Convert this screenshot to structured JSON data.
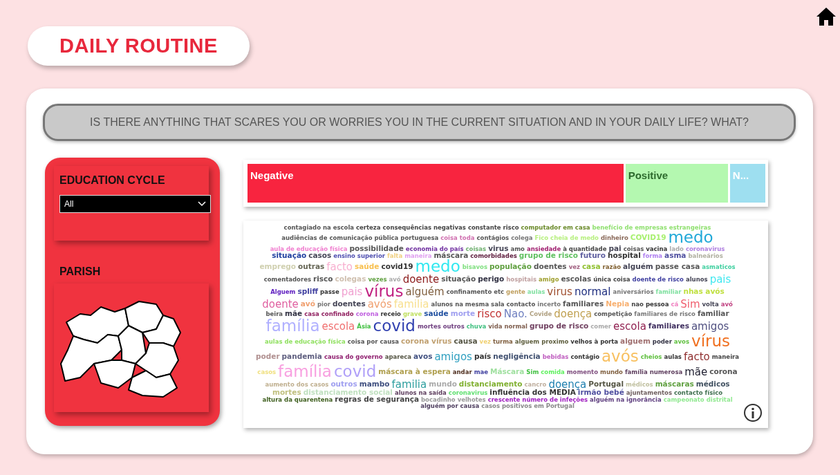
{
  "title": "DAILY ROUTINE",
  "question": "IS THERE ANYTHING THAT SCARES YOU OR WORRIES YOU IN THE CURRENT SITUATION AND IN YOUR DAILY LIFE? WHAT?",
  "filters": {
    "education_cycle": {
      "label": "EDUCATION CYCLE",
      "value": "All"
    },
    "parish": {
      "label": "PARISH"
    }
  },
  "segments": [
    {
      "label": "Negative",
      "color": "#f8243f"
    },
    {
      "label": "Positive",
      "color": "#b4f8b0"
    },
    {
      "label": "N...",
      "color": "#9edff0"
    }
  ],
  "words": [
    {
      "text": "contagiado na escola",
      "color": "#555555",
      "kind": "s"
    },
    {
      "text": "certeza consequências negativas",
      "color": "#444444",
      "kind": "s"
    },
    {
      "text": "constante risco",
      "color": "#444444",
      "kind": "s"
    },
    {
      "text": "computador em casa",
      "color": "#6a8a2a",
      "kind": "s"
    },
    {
      "text": "benefício de empresas estrangeiras",
      "color": "#90e070",
      "kind": "s"
    },
    {
      "text": "audiências de comunicação pública portuguesa",
      "color": "#555555",
      "kind": "s"
    },
    {
      "text": "coisa toda",
      "color": "#d070b0",
      "kind": "s"
    },
    {
      "text": "contágios",
      "color": "#555555",
      "kind": "s"
    },
    {
      "text": "colega",
      "color": "#777777",
      "kind": "s"
    },
    {
      "text": "Fico cheia de medo",
      "color": "#b8f080",
      "kind": "s"
    },
    {
      "text": "dinheiro",
      "color": "#8a6a5a",
      "kind": "s"
    },
    {
      "text": "COVID19",
      "color": "#a8f070",
      "kind": "m"
    },
    {
      "text": "medo",
      "color": "#20a8d8",
      "kind": "xl"
    },
    {
      "text": "aula de educação física",
      "color": "#f080d0",
      "kind": "s"
    },
    {
      "text": "possibilidade",
      "color": "#555555",
      "kind": "m"
    },
    {
      "text": "economia do país",
      "color": "#7030a0",
      "kind": "s"
    },
    {
      "text": "coisas",
      "color": "#70b070",
      "kind": "s"
    },
    {
      "text": "virus",
      "color": "#444455",
      "kind": "m"
    },
    {
      "text": "amo",
      "color": "#555555",
      "kind": "s"
    },
    {
      "text": "ansiedade",
      "color": "#a02070",
      "kind": "s"
    },
    {
      "text": "à quantidade",
      "color": "#444444",
      "kind": "s"
    },
    {
      "text": "pai",
      "color": "#444455",
      "kind": "m"
    },
    {
      "text": "coisas",
      "color": "#555555",
      "kind": "s"
    },
    {
      "text": "vacina",
      "color": "#333333",
      "kind": "s"
    },
    {
      "text": "lado",
      "color": "#aaaaaa",
      "kind": "s"
    },
    {
      "text": "coronavirus",
      "color": "#b080e0",
      "kind": "s"
    },
    {
      "text": "situação",
      "color": "#2040a0",
      "kind": "m"
    },
    {
      "text": "casos",
      "color": "#444455",
      "kind": "m"
    },
    {
      "text": "ensino superior",
      "color": "#5050b0",
      "kind": "s"
    },
    {
      "text": "falta",
      "color": "#f0d080",
      "kind": "s"
    },
    {
      "text": "maneira",
      "color": "#e0a0f0",
      "kind": "s"
    },
    {
      "text": "máscara",
      "color": "#555555",
      "kind": "m"
    },
    {
      "text": "comorbidades",
      "color": "#602040",
      "kind": "s"
    },
    {
      "text": "grupo de risco",
      "color": "#60c060",
      "kind": "m"
    },
    {
      "text": "futuro",
      "color": "#6060a0",
      "kind": "m"
    },
    {
      "text": "hospital",
      "color": "#333333",
      "kind": "m"
    },
    {
      "text": "forma",
      "color": "#b080f0",
      "kind": "s"
    },
    {
      "text": "asma",
      "color": "#5050a0",
      "kind": "m"
    },
    {
      "text": "balneários",
      "color": "#b0b0a0",
      "kind": "s"
    },
    {
      "text": "emprego",
      "color": "#d0d0b0",
      "kind": "m"
    },
    {
      "text": "outras",
      "color": "#666655",
      "kind": "m"
    },
    {
      "text": "facto",
      "color": "#f8b0d0",
      "kind": "l"
    },
    {
      "text": "saúde",
      "color": "#f8c050",
      "kind": "m"
    },
    {
      "text": "covid19",
      "color": "#333333",
      "kind": "m"
    },
    {
      "text": "medo",
      "color": "#30e8f0",
      "kind": "xl"
    },
    {
      "text": "bisavos",
      "color": "#80e080",
      "kind": "s"
    },
    {
      "text": "população",
      "color": "#60a040",
      "kind": "m"
    },
    {
      "text": "doentes",
      "color": "#555555",
      "kind": "m"
    },
    {
      "text": "vez",
      "color": "#a06080",
      "kind": "s"
    },
    {
      "text": "casa",
      "color": "#90c030",
      "kind": "m"
    },
    {
      "text": "razão",
      "color": "#806030",
      "kind": "s"
    },
    {
      "text": "alguém",
      "color": "#444455",
      "kind": "m"
    },
    {
      "text": "passe casa",
      "color": "#555555",
      "kind": "m"
    },
    {
      "text": "asmaticos",
      "color": "#40d0a0",
      "kind": "s"
    },
    {
      "text": "comentadores",
      "color": "#555555",
      "kind": "s"
    },
    {
      "text": "risco",
      "color": "#555555",
      "kind": "m"
    },
    {
      "text": "colegas",
      "color": "#d0c0b0",
      "kind": "m"
    },
    {
      "text": "vezes",
      "color": "#60a040",
      "kind": "s"
    },
    {
      "text": "avó",
      "color": "#aaaaaa",
      "kind": "s"
    },
    {
      "text": "doente",
      "color": "#8b1a1a",
      "kind": "l"
    },
    {
      "text": "situação",
      "color": "#555555",
      "kind": "m"
    },
    {
      "text": "perigo",
      "color": "#333344",
      "kind": "m"
    },
    {
      "text": "hospitais",
      "color": "#c0a0a0",
      "kind": "s"
    },
    {
      "text": "amigo",
      "color": "#a0a030",
      "kind": "s"
    },
    {
      "text": "escolas",
      "color": "#555555",
      "kind": "m"
    },
    {
      "text": "única coisa",
      "color": "#444444",
      "kind": "s"
    },
    {
      "text": "doente de risco",
      "color": "#4040a0",
      "kind": "s"
    },
    {
      "text": "alunos",
      "color": "#444455",
      "kind": "s"
    },
    {
      "text": "pais",
      "color": "#40e8f0",
      "kind": "l"
    },
    {
      "text": "Alguem",
      "color": "#6020c0",
      "kind": "s"
    },
    {
      "text": "spliff",
      "color": "#4040a0",
      "kind": "m"
    },
    {
      "text": "passe",
      "color": "#333333",
      "kind": "s"
    },
    {
      "text": "pais",
      "color": "#f0a0d0",
      "kind": "l"
    },
    {
      "text": "vírus",
      "color": "#c02080",
      "kind": "xl"
    },
    {
      "text": "alguém",
      "color": "#806040",
      "kind": "l"
    },
    {
      "text": "confinamento",
      "color": "#555555",
      "kind": "s"
    },
    {
      "text": "etc",
      "color": "#555555",
      "kind": "s"
    },
    {
      "text": "gente",
      "color": "#c0a060",
      "kind": "s"
    },
    {
      "text": "aulas",
      "color": "#80e0a0",
      "kind": "s"
    },
    {
      "text": "virus",
      "color": "#a05030",
      "kind": "l"
    },
    {
      "text": "normal",
      "color": "#203080",
      "kind": "l"
    },
    {
      "text": "aniversários",
      "color": "#777777",
      "kind": "s"
    },
    {
      "text": "familiar",
      "color": "#80e0a0",
      "kind": "s"
    },
    {
      "text": "nhas avós",
      "color": "#c0e040",
      "kind": "m"
    },
    {
      "text": "doente",
      "color": "#e060a0",
      "kind": "l"
    },
    {
      "text": "avó",
      "color": "#f0a070",
      "kind": "m"
    },
    {
      "text": "pior",
      "color": "#777777",
      "kind": "s"
    },
    {
      "text": "doentes",
      "color": "#444455",
      "kind": "m"
    },
    {
      "text": "avós",
      "color": "#f0a070",
      "kind": "l"
    },
    {
      "text": "familia",
      "color": "#f8e090",
      "kind": "l"
    },
    {
      "text": "alunos na mesma sala",
      "color": "#555555",
      "kind": "s"
    },
    {
      "text": "contacto",
      "color": "#555555",
      "kind": "s"
    },
    {
      "text": "incerto",
      "color": "#777777",
      "kind": "s"
    },
    {
      "text": "familiares",
      "color": "#555555",
      "kind": "m"
    },
    {
      "text": "Nepia",
      "color": "#f8b070",
      "kind": "m"
    },
    {
      "text": "nao",
      "color": "#444444",
      "kind": "s"
    },
    {
      "text": "pessoa",
      "color": "#333333",
      "kind": "s"
    },
    {
      "text": "cá",
      "color": "#f080c0",
      "kind": "s"
    },
    {
      "text": "Sim",
      "color": "#f06070",
      "kind": "l"
    },
    {
      "text": "volta",
      "color": "#444455",
      "kind": "s"
    },
    {
      "text": "avó",
      "color": "#c04080",
      "kind": "s"
    },
    {
      "text": "beira",
      "color": "#555555",
      "kind": "s"
    },
    {
      "text": "mãe",
      "color": "#333344",
      "kind": "m"
    },
    {
      "text": "casa confinado",
      "color": "#902060",
      "kind": "s"
    },
    {
      "text": "corona",
      "color": "#c060e0",
      "kind": "s"
    },
    {
      "text": "receio",
      "color": "#333333",
      "kind": "s"
    },
    {
      "text": "grave",
      "color": "#c0e060",
      "kind": "s"
    },
    {
      "text": "saúde",
      "color": "#2050a0",
      "kind": "m"
    },
    {
      "text": "morte",
      "color": "#a0a0f0",
      "kind": "m"
    },
    {
      "text": "risco",
      "color": "#c03030",
      "kind": "l"
    },
    {
      "text": "Nao.",
      "color": "#7080c0",
      "kind": "l"
    },
    {
      "text": "Covide",
      "color": "#b0a080",
      "kind": "s"
    },
    {
      "text": "doença",
      "color": "#c0a050",
      "kind": "l"
    },
    {
      "text": "competição",
      "color": "#555555",
      "kind": "s"
    },
    {
      "text": "familiares de risco",
      "color": "#777777",
      "kind": "s"
    },
    {
      "text": "familiar",
      "color": "#555555",
      "kind": "m"
    },
    {
      "text": "família",
      "color": "#b0b0ff",
      "kind": "xl"
    },
    {
      "text": "escola",
      "color": "#f07070",
      "kind": "l"
    },
    {
      "text": "Ásia",
      "color": "#40c040",
      "kind": "s"
    },
    {
      "text": "covid",
      "color": "#3040b0",
      "kind": "xl"
    },
    {
      "text": "mortes",
      "color": "#704080",
      "kind": "s"
    },
    {
      "text": "outros",
      "color": "#704080",
      "kind": "s"
    },
    {
      "text": "chuva",
      "color": "#40c080",
      "kind": "s"
    },
    {
      "text": "vida normal",
      "color": "#806050",
      "kind": "s"
    },
    {
      "text": "grupo de risco",
      "color": "#704060",
      "kind": "m"
    },
    {
      "text": "comer",
      "color": "#aaaaaa",
      "kind": "s"
    },
    {
      "text": "escola",
      "color": "#902050",
      "kind": "l"
    },
    {
      "text": "familiares",
      "color": "#403060",
      "kind": "m"
    },
    {
      "text": "amigos",
      "color": "#505080",
      "kind": "l"
    },
    {
      "text": "aulas de educação física",
      "color": "#90e060",
      "kind": "s"
    },
    {
      "text": "coisa por causa",
      "color": "#555555",
      "kind": "s"
    },
    {
      "text": "corona vírus",
      "color": "#c0a070",
      "kind": "m"
    },
    {
      "text": "causa",
      "color": "#555544",
      "kind": "m"
    },
    {
      "text": "vez",
      "color": "#f0d070",
      "kind": "s"
    },
    {
      "text": "turma",
      "color": "#806040",
      "kind": "s"
    },
    {
      "text": "alguem proximo",
      "color": "#606040",
      "kind": "s"
    },
    {
      "text": "velhos à porta",
      "color": "#333333",
      "kind": "s"
    },
    {
      "text": "alguem",
      "color": "#a07070",
      "kind": "m"
    },
    {
      "text": "poder",
      "color": "#333344",
      "kind": "s"
    },
    {
      "text": "avos",
      "color": "#60c040",
      "kind": "s"
    },
    {
      "text": "vírus",
      "color": "#f07020",
      "kind": "xl"
    },
    {
      "text": "poder",
      "color": "#b09090",
      "kind": "m"
    },
    {
      "text": "pandemia",
      "color": "#606080",
      "kind": "m"
    },
    {
      "text": "causa do governo",
      "color": "#902070",
      "kind": "s"
    },
    {
      "text": "apareca",
      "color": "#555544",
      "kind": "s"
    },
    {
      "text": "avos",
      "color": "#405080",
      "kind": "m"
    },
    {
      "text": "amigos",
      "color": "#30a0c0",
      "kind": "l"
    },
    {
      "text": "país",
      "color": "#333333",
      "kind": "m"
    },
    {
      "text": "negligência",
      "color": "#405070",
      "kind": "m"
    },
    {
      "text": "bebidas",
      "color": "#c060c0",
      "kind": "s"
    },
    {
      "text": "contágio",
      "color": "#333333",
      "kind": "s"
    },
    {
      "text": "avós",
      "color": "#f8c060",
      "kind": "xl"
    },
    {
      "text": "cheios",
      "color": "#60c040",
      "kind": "s"
    },
    {
      "text": "aulas",
      "color": "#333333",
      "kind": "s"
    },
    {
      "text": "facto",
      "color": "#903030",
      "kind": "l"
    },
    {
      "text": "maneira",
      "color": "#444444",
      "kind": "s"
    },
    {
      "text": "casos",
      "color": "#f0e080",
      "kind": "s"
    },
    {
      "text": "família",
      "color": "#f8a0e0",
      "kind": "xl"
    },
    {
      "text": "covid",
      "color": "#b0a0f8",
      "kind": "xl"
    },
    {
      "text": "máscara à espera",
      "color": "#b0a050",
      "kind": "m"
    },
    {
      "text": "andar",
      "color": "#503020",
      "kind": "s"
    },
    {
      "text": "mae",
      "color": "#4040a0",
      "kind": "s"
    },
    {
      "text": "Máscara",
      "color": "#a0e0a0",
      "kind": "m"
    },
    {
      "text": "Sim",
      "color": "#40c040",
      "kind": "s"
    },
    {
      "text": "comida",
      "color": "#60f060",
      "kind": "s"
    },
    {
      "text": "momento",
      "color": "#805080",
      "kind": "s"
    },
    {
      "text": "mundo",
      "color": "#806040",
      "kind": "s"
    },
    {
      "text": "família numerosa",
      "color": "#604060",
      "kind": "s"
    },
    {
      "text": "mãe",
      "color": "#222233",
      "kind": "l"
    },
    {
      "text": "corona",
      "color": "#555555",
      "kind": "m"
    },
    {
      "text": "aumento dos casos",
      "color": "#c0b090",
      "kind": "s"
    },
    {
      "text": "outros",
      "color": "#a0a0f0",
      "kind": "m"
    },
    {
      "text": "mambo",
      "color": "#405080",
      "kind": "m"
    },
    {
      "text": "familia",
      "color": "#30a0a0",
      "kind": "l"
    },
    {
      "text": "mundo",
      "color": "#aaaaaa",
      "kind": "m"
    },
    {
      "text": "distanciamento",
      "color": "#80b030",
      "kind": "m"
    },
    {
      "text": "cancro",
      "color": "#c0b0a0",
      "kind": "s"
    },
    {
      "text": "doença",
      "color": "#2080b0",
      "kind": "l"
    },
    {
      "text": "Portugal",
      "color": "#555544",
      "kind": "m"
    },
    {
      "text": "médicos",
      "color": "#c0c0a0",
      "kind": "s"
    },
    {
      "text": "máscaras",
      "color": "#60a040",
      "kind": "m"
    },
    {
      "text": "médicos",
      "color": "#405060",
      "kind": "m"
    },
    {
      "text": "mortes",
      "color": "#c0c080",
      "kind": "m"
    },
    {
      "text": "distanciamento social",
      "color": "#c0e0c0",
      "kind": "m"
    },
    {
      "text": "alunos na saída",
      "color": "#604060",
      "kind": "s"
    },
    {
      "text": "coronavirus",
      "color": "#60e070",
      "kind": "s"
    },
    {
      "text": "influência dos MEDIA",
      "color": "#333333",
      "kind": "m"
    },
    {
      "text": "irmão bebé",
      "color": "#5050a0",
      "kind": "m"
    },
    {
      "text": "ajuntamentos",
      "color": "#706060",
      "kind": "s"
    },
    {
      "text": "contacto físico",
      "color": "#407050",
      "kind": "s"
    },
    {
      "text": "altura da quarentena",
      "color": "#406020",
      "kind": "s"
    },
    {
      "text": "regras de segurança",
      "color": "#444444",
      "kind": "m"
    },
    {
      "text": "bocadinho velhotes",
      "color": "#999999",
      "kind": "s"
    },
    {
      "text": "crescente número de infeções",
      "color": "#a020c0",
      "kind": "s"
    },
    {
      "text": "alguém na ignorância",
      "color": "#604080",
      "kind": "s"
    },
    {
      "text": "campeonato distrital",
      "color": "#90e890",
      "kind": "s"
    },
    {
      "text": "alguém por causa",
      "color": "#504060",
      "kind": "s"
    },
    {
      "text": "casos positivos em Portugal",
      "color": "#888888",
      "kind": "s"
    }
  ]
}
